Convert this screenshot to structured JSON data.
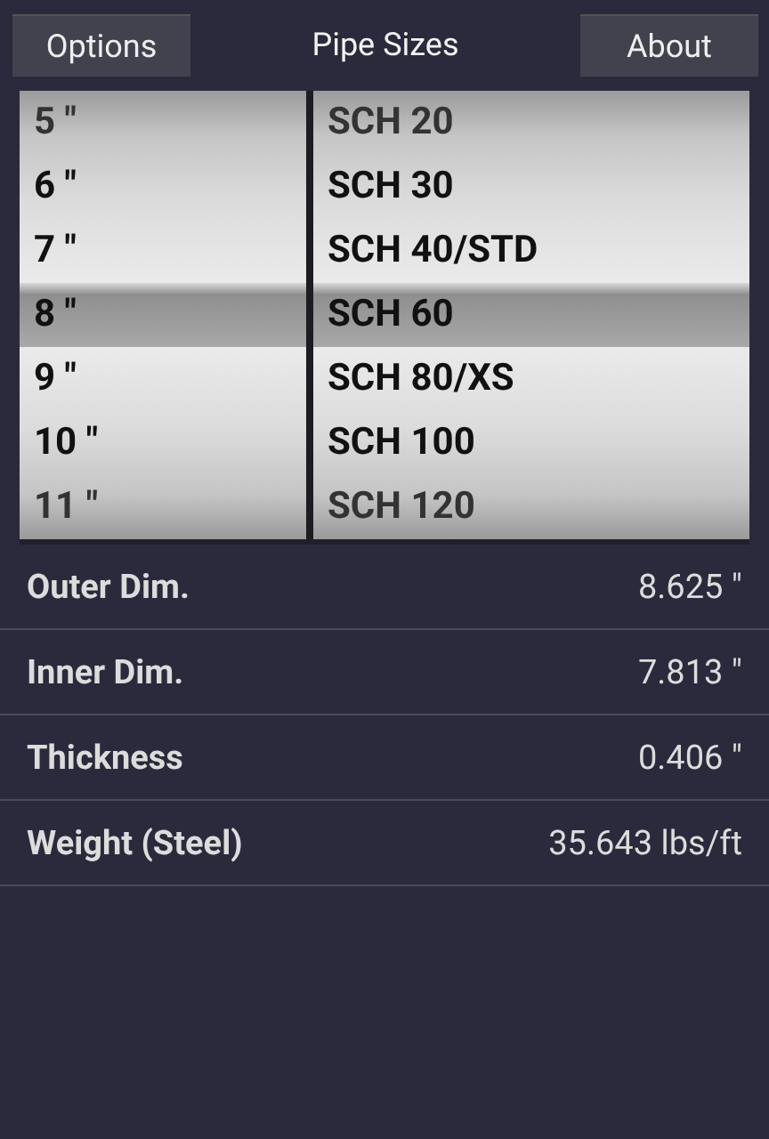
{
  "header": {
    "left_button": "Options",
    "title": "Pipe Sizes",
    "right_button": "About"
  },
  "picker": {
    "sizes": [
      {
        "label": "5 \"",
        "selected": false
      },
      {
        "label": "6 \"",
        "selected": false
      },
      {
        "label": "7 \"",
        "selected": false
      },
      {
        "label": "8 \"",
        "selected": true
      },
      {
        "label": "9 \"",
        "selected": false
      },
      {
        "label": "10 \"",
        "selected": false
      },
      {
        "label": "11 \"",
        "selected": false
      }
    ],
    "schedules": [
      {
        "label": "SCH 20",
        "selected": false
      },
      {
        "label": "SCH 30",
        "selected": false
      },
      {
        "label": "SCH 40/STD",
        "selected": false
      },
      {
        "label": "SCH 60",
        "selected": true
      },
      {
        "label": "SCH 80/XS",
        "selected": false
      },
      {
        "label": "SCH 100",
        "selected": false
      },
      {
        "label": "SCH 120",
        "selected": false
      }
    ]
  },
  "details": [
    {
      "label": "Outer Dim.",
      "value": "8.625 \""
    },
    {
      "label": "Inner Dim.",
      "value": "7.813 \""
    },
    {
      "label": "Thickness",
      "value": "0.406 \""
    },
    {
      "label": "Weight (Steel)",
      "value": "35.643 lbs/ft"
    }
  ]
}
